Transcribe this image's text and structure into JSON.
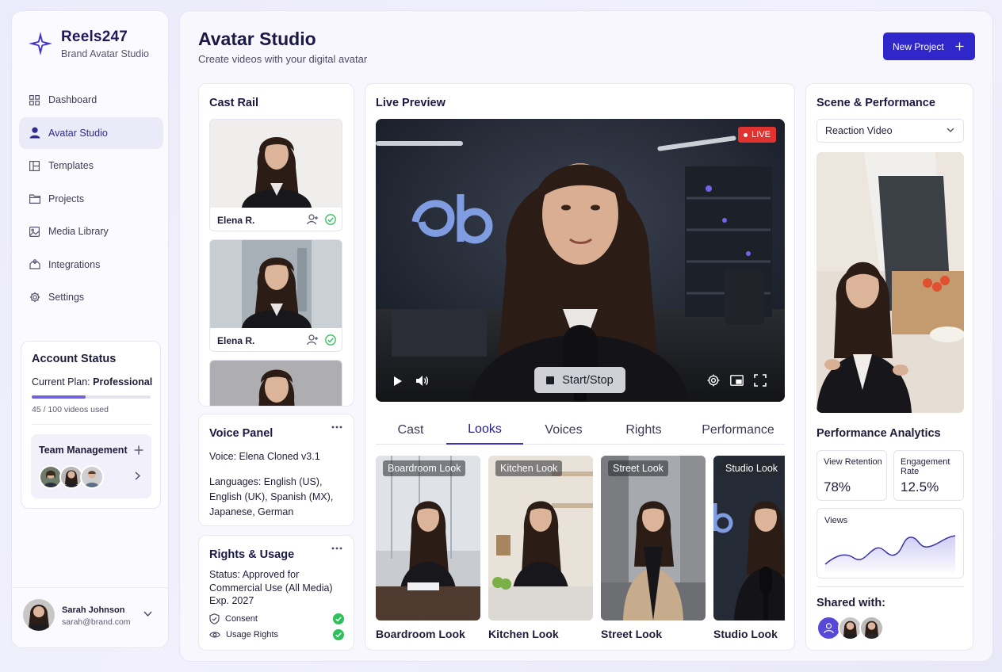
{
  "brand": {
    "name": "Reels247",
    "subtitle": "Brand Avatar Studio"
  },
  "sidebar": {
    "items": [
      {
        "label": "Dashboard",
        "icon": "grid-icon"
      },
      {
        "label": "Avatar Studio",
        "icon": "user-icon",
        "active": true
      },
      {
        "label": "Templates",
        "icon": "layout-icon"
      },
      {
        "label": "Projects",
        "icon": "folder-icon"
      },
      {
        "label": "Media Library",
        "icon": "image-icon"
      },
      {
        "label": "Integrations",
        "icon": "puzzle-icon"
      },
      {
        "label": "Settings",
        "icon": "gear-icon"
      }
    ],
    "account": {
      "title": "Account Status",
      "plan_prefix": "Current Plan:",
      "plan": "Professional",
      "usage": "45 / 100 videos used",
      "usage_fraction": 0.45,
      "team_title": "Team Management"
    },
    "user": {
      "name": "Sarah Johnson",
      "email": "sarah@brand.com"
    }
  },
  "header": {
    "title": "Avatar Studio",
    "subtitle": "Create videos with your digital avatar",
    "new_project": "New Project"
  },
  "cast_rail": {
    "title": "Cast Rail",
    "items": [
      {
        "name": "Elena R."
      },
      {
        "name": "Elena R."
      }
    ]
  },
  "voice_panel": {
    "title": "Voice Panel",
    "voice": "Voice: Elena Cloned v3.1",
    "languages": "Languages: English (US), English (UK), Spanish (MX), Japanese, German"
  },
  "rights": {
    "title": "Rights & Usage",
    "status": "Status: Approved for Commercial Use (All Media) Exp. 2027",
    "rows": [
      {
        "label": "Consent"
      },
      {
        "label": "Usage Rights"
      }
    ]
  },
  "live_preview": {
    "title": "Live Preview",
    "live_badge": "LIVE",
    "start_stop": "Start/Stop",
    "tabs": [
      "Cast",
      "Looks",
      "Voices",
      "Rights",
      "Performance"
    ],
    "active_tab": "Looks",
    "looks": [
      {
        "tag": "Boardroom Look",
        "label": "Boardroom Look"
      },
      {
        "tag": "Kitchen Look",
        "label": "Kitchen Look"
      },
      {
        "tag": "Street Look",
        "label": "Street Look"
      },
      {
        "tag": "Studio Look",
        "label": "Studio Look"
      }
    ]
  },
  "scene": {
    "title": "Scene & Performance",
    "select_value": "Reaction Video",
    "analytics_title": "Performance Analytics",
    "metrics": [
      {
        "label": "View Retention",
        "value": "78%"
      },
      {
        "label": "Engagement Rate",
        "value": "12.5%"
      }
    ],
    "views_label": "Views",
    "shared_title": "Shared with:"
  },
  "colors": {
    "accent": "#2f27c9",
    "live": "#e0322e",
    "check": "#2fbf5b"
  }
}
